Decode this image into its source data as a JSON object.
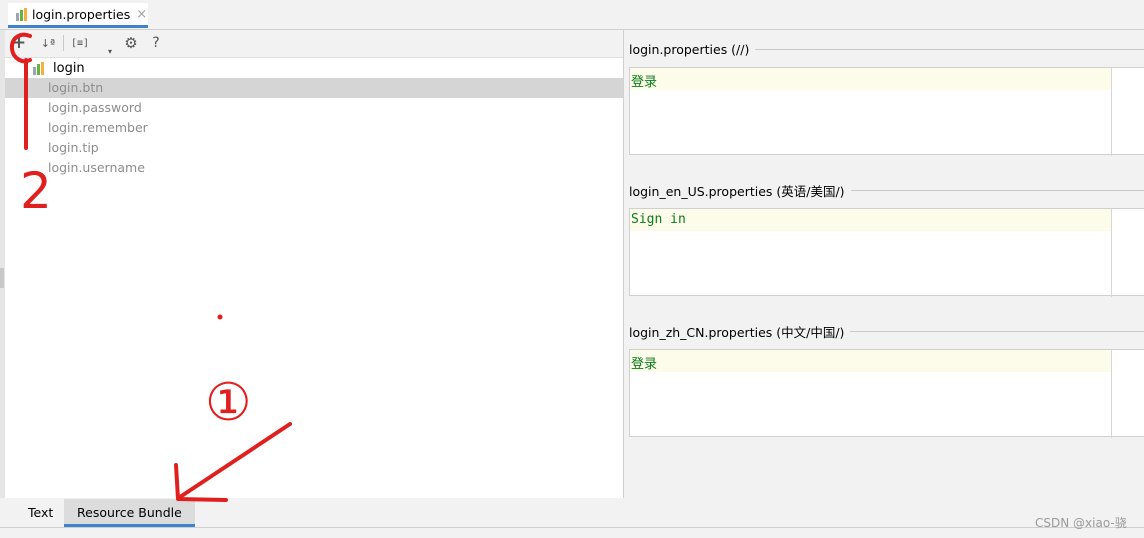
{
  "editor_tab": {
    "label": "login.properties",
    "close_glyph": "×"
  },
  "toolbar": {
    "add": "+",
    "sort": "↓ª",
    "group": "[≡]",
    "settings": "⚙",
    "help": "?"
  },
  "tree": {
    "root": "login",
    "items": [
      "login.btn",
      "login.password",
      "login.remember",
      "login.tip",
      "login.username"
    ],
    "selected_index": 0
  },
  "bottom_tabs": [
    "Text",
    "Resource Bundle"
  ],
  "active_bottom_tab": "Resource Bundle",
  "sections": [
    {
      "title": "login.properties (//)",
      "value": "登录"
    },
    {
      "title": "login_en_US.properties (英语/美国/)",
      "value": "Sign in"
    },
    {
      "title": "login_zh_CN.properties (中文/中国/)",
      "value": "登录"
    }
  ],
  "annotations": {
    "circle_one": "①",
    "two": "2"
  },
  "watermark": "CSDN @xiao-骁",
  "colors": {
    "accent": "#4083c9",
    "value_green": "#067d17",
    "annotation_red": "#e0201e"
  }
}
